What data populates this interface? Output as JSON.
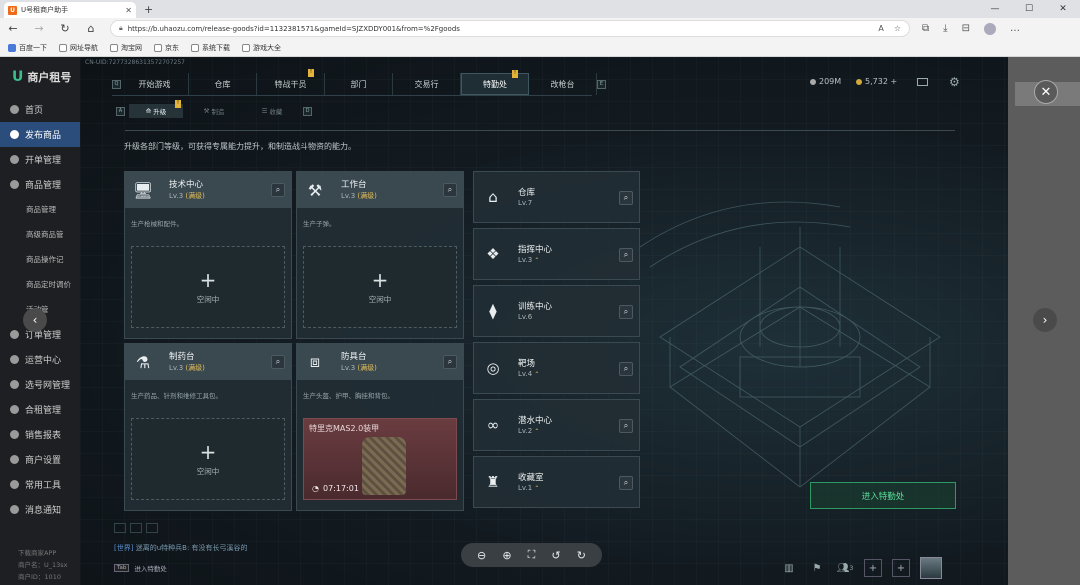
{
  "browser": {
    "tab_title": "U号租商户助手",
    "tab_logo": "U",
    "url": "https://b.uhaozu.com/release-goods?id=1132381571&gameId=SJZXDDY001&from=%2Fgoods",
    "bookmarks": [
      "百度一下",
      "网址导航",
      "淘宝网",
      "京东",
      "系统下载",
      "游戏大全"
    ]
  },
  "sidebar": {
    "logo_text": "商户租号",
    "logo_letter": "U",
    "items": [
      {
        "label": "首页"
      },
      {
        "label": "发布商品",
        "active": true
      },
      {
        "label": "开单管理"
      },
      {
        "label": "商品管理"
      }
    ],
    "sub_items": [
      "商品管理",
      "高级商品管",
      "商品操作记",
      "商品定时调价",
      "活动管"
    ],
    "items2": [
      {
        "label": "订单管理"
      },
      {
        "label": "运营中心"
      },
      {
        "label": "选号网管理"
      },
      {
        "label": "合租管理"
      },
      {
        "label": "销售报表"
      },
      {
        "label": "商户设置"
      },
      {
        "label": "常用工具"
      },
      {
        "label": "消息通知"
      }
    ],
    "footer": [
      "下载商家APP",
      "商户名：U_13sx",
      "商户ID：1010"
    ]
  },
  "game": {
    "uid": "CN-UID:72773286313572707257",
    "tabs": [
      {
        "label": "开始游戏"
      },
      {
        "label": "仓库"
      },
      {
        "label": "特战干员",
        "badge": true
      },
      {
        "label": "部门"
      },
      {
        "label": "交易行"
      },
      {
        "label": "特勤处",
        "active": true,
        "badge": true
      },
      {
        "label": "改枪台"
      }
    ],
    "tab_keys": [
      "Q",
      "E"
    ],
    "resources": {
      "silver": "209M",
      "gold": "5,732 +"
    },
    "sub_tabs": [
      {
        "label": "升级",
        "active": true
      },
      {
        "label": "制造"
      },
      {
        "label": "收藏"
      }
    ],
    "sub_keys": [
      "A",
      "D"
    ],
    "description": "升级各部门等级，可获得专属能力提升，和制造战斗物资的能力。",
    "cards": [
      {
        "title": "技术中心",
        "level": "Lv.3",
        "status": "(满级)",
        "desc": "生产枪械和配件。",
        "slot": "空闲中"
      },
      {
        "title": "工作台",
        "level": "Lv.3",
        "status": "(满级)",
        "desc": "生产子弹。",
        "slot": "空闲中"
      },
      {
        "title": "制药台",
        "level": "Lv.3",
        "status": "(满级)",
        "desc": "生产药品、针剂和维修工具包。",
        "slot": "空闲中"
      },
      {
        "title": "防具台",
        "level": "Lv.3",
        "status": "(满级)",
        "desc": "生产头盔、护甲、胸挂和背包。",
        "item_name": "特里克MAS2.0装甲",
        "timer": "07:17:01"
      }
    ],
    "right_cards": [
      {
        "title": "仓库",
        "level": "Lv.7"
      },
      {
        "title": "指挥中心",
        "level": "Lv.3"
      },
      {
        "title": "训练中心",
        "level": "Lv.6"
      },
      {
        "title": "靶场",
        "level": "Lv.4"
      },
      {
        "title": "潜水中心",
        "level": "Lv.2"
      },
      {
        "title": "收藏室",
        "level": "Lv.1"
      }
    ],
    "enter_button": "进入特勤处",
    "chat_channel": "[世界]",
    "chat_text": "迷离的u特种兵B: 有没有长弓溪谷的",
    "tab_hint_key": "Tab",
    "tab_hint_text": "进入特勤处",
    "friends_count": "3"
  },
  "icons": {
    "close": "close-icon",
    "search": "search-icon",
    "zoom_out": "zoom-out-icon",
    "zoom_in": "zoom-in-icon",
    "fullscreen": "fullscreen-icon",
    "rotate_left": "rotate-left-icon",
    "rotate_right": "rotate-right-icon"
  },
  "colors": {
    "accent_green": "#59e09a",
    "level_gold": "#e6c05a",
    "sidebar_active": "#2a4d7c"
  }
}
